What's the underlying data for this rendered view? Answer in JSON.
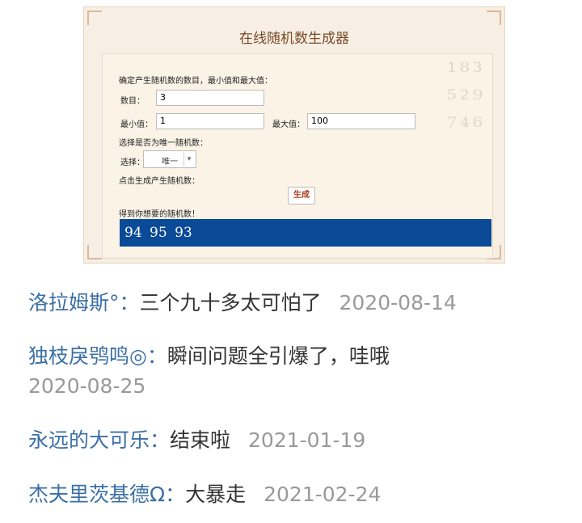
{
  "generator": {
    "title": "在线随机数生成器",
    "decor_digits": "¹ ⁸ ³\n⁵ ² ⁹\n⁷ ⁴ ⁶",
    "intro": "确定产生随机数的数目，最小值和最大值：",
    "count_label": "数目：",
    "count_value": "3",
    "min_label": "最小值：",
    "min_value": "1",
    "max_label": "最大值：",
    "max_value": "100",
    "unique_prompt": "选择是否为唯一随机数：",
    "select_label": "选择：",
    "select_value": "唯一",
    "generate_prompt": "点击生成产生随机数：",
    "generate_button": "生成",
    "result_label": "得到你想要的随机数！",
    "result_value": "94 95 93"
  },
  "comments": [
    {
      "user": "洛拉姆斯°：",
      "text": "三个九十多太可怕了",
      "date": "2020-08-14"
    },
    {
      "user": "独枝戾鸮鸣◎：",
      "text": "瞬间问题全引爆了，哇哦",
      "date": "2020-08-25"
    },
    {
      "user": "永远的大可乐：",
      "text": "结束啦",
      "date": "2021-01-19"
    },
    {
      "user": "杰夫里茨基德Ω：",
      "text": "大暴走",
      "date": "2021-02-24"
    }
  ],
  "colors": {
    "username": "#3b6fa5",
    "date": "#999999",
    "result_bg": "#0a4a96",
    "button_text": "#b03a1a"
  }
}
